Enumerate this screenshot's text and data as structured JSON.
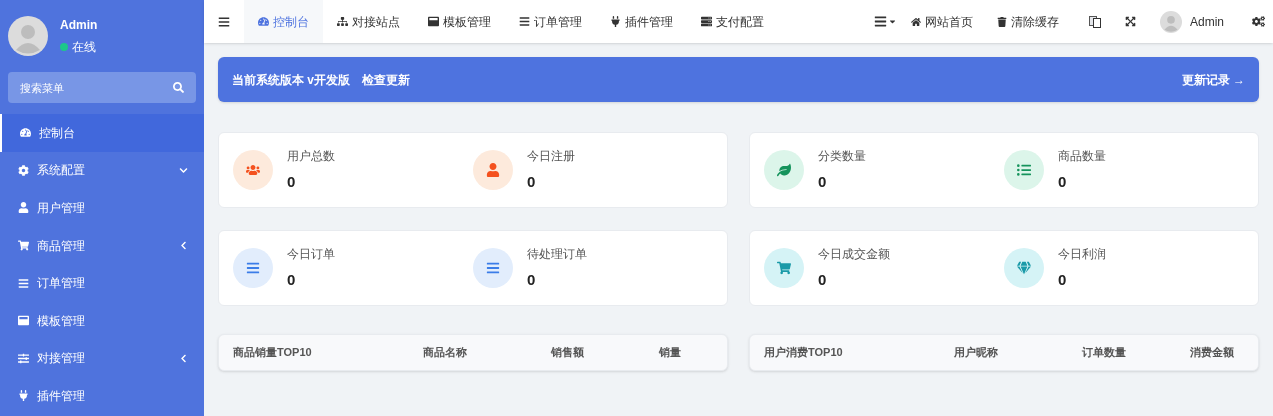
{
  "user": {
    "name": "Admin",
    "status": "在线",
    "online": true
  },
  "search": {
    "placeholder": "搜索菜单"
  },
  "sidebar": {
    "items": [
      {
        "label": "控制台",
        "kind": "link",
        "selected": true
      },
      {
        "label": "系统配置",
        "kind": "group",
        "expanded": true,
        "selected": false
      },
      {
        "label": "用户管理",
        "kind": "link",
        "selected": false
      },
      {
        "label": "商品管理",
        "kind": "group",
        "expanded": false,
        "selected": false
      },
      {
        "label": "订单管理",
        "kind": "link",
        "selected": false
      },
      {
        "label": "模板管理",
        "kind": "link",
        "selected": false
      },
      {
        "label": "对接管理",
        "kind": "group",
        "expanded": false,
        "selected": false
      },
      {
        "label": "插件管理",
        "kind": "link",
        "selected": false
      }
    ]
  },
  "tabs": [
    {
      "label": "控制台",
      "selected": true
    },
    {
      "label": "对接站点",
      "selected": false
    },
    {
      "label": "模板管理",
      "selected": false
    },
    {
      "label": "订单管理",
      "selected": false
    },
    {
      "label": "插件管理",
      "selected": false
    },
    {
      "label": "支付配置",
      "selected": false
    }
  ],
  "toolbar": [
    "网站首页",
    "清除缓存"
  ],
  "header_user": "Admin",
  "banner": {
    "version": "当前系统版本 v开发版",
    "check": "检查更新",
    "log": "更新记录 →"
  },
  "stat_cards": [
    {
      "stats": [
        {
          "label": "用户总数",
          "value": "0"
        },
        {
          "label": "今日注册",
          "value": "0"
        }
      ]
    },
    {
      "stats": [
        {
          "label": "分类数量",
          "value": "0"
        },
        {
          "label": "商品数量",
          "value": "0"
        }
      ]
    },
    {
      "stats": [
        {
          "label": "今日订单",
          "value": "0"
        },
        {
          "label": "待处理订单",
          "value": "0"
        }
      ]
    },
    {
      "stats": [
        {
          "label": "今日成交金额",
          "value": "0"
        },
        {
          "label": "今日利润",
          "value": "0"
        }
      ]
    }
  ],
  "tables": [
    {
      "columns": [
        "商品销量TOP10",
        "商品名称",
        "销售额",
        "销量"
      ]
    },
    {
      "columns": [
        "用户消费TOP10",
        "用户昵称",
        "订单数量",
        "消费金额"
      ]
    }
  ]
}
